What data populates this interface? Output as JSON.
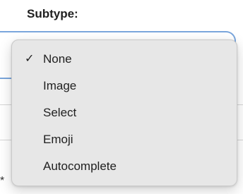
{
  "field": {
    "label": "Subtype:"
  },
  "background": {
    "asterisk": "*"
  },
  "menu": {
    "checkmark": "✓",
    "selected": "None",
    "items": [
      {
        "label": "None",
        "checked": true
      },
      {
        "label": "Image",
        "checked": false
      },
      {
        "label": "Select",
        "checked": false
      },
      {
        "label": "Emoji",
        "checked": false
      },
      {
        "label": "Autocomplete",
        "checked": false
      }
    ]
  },
  "colors": {
    "focus_ring": "#7aa6dc",
    "menu_background": "#e7e7e7"
  }
}
